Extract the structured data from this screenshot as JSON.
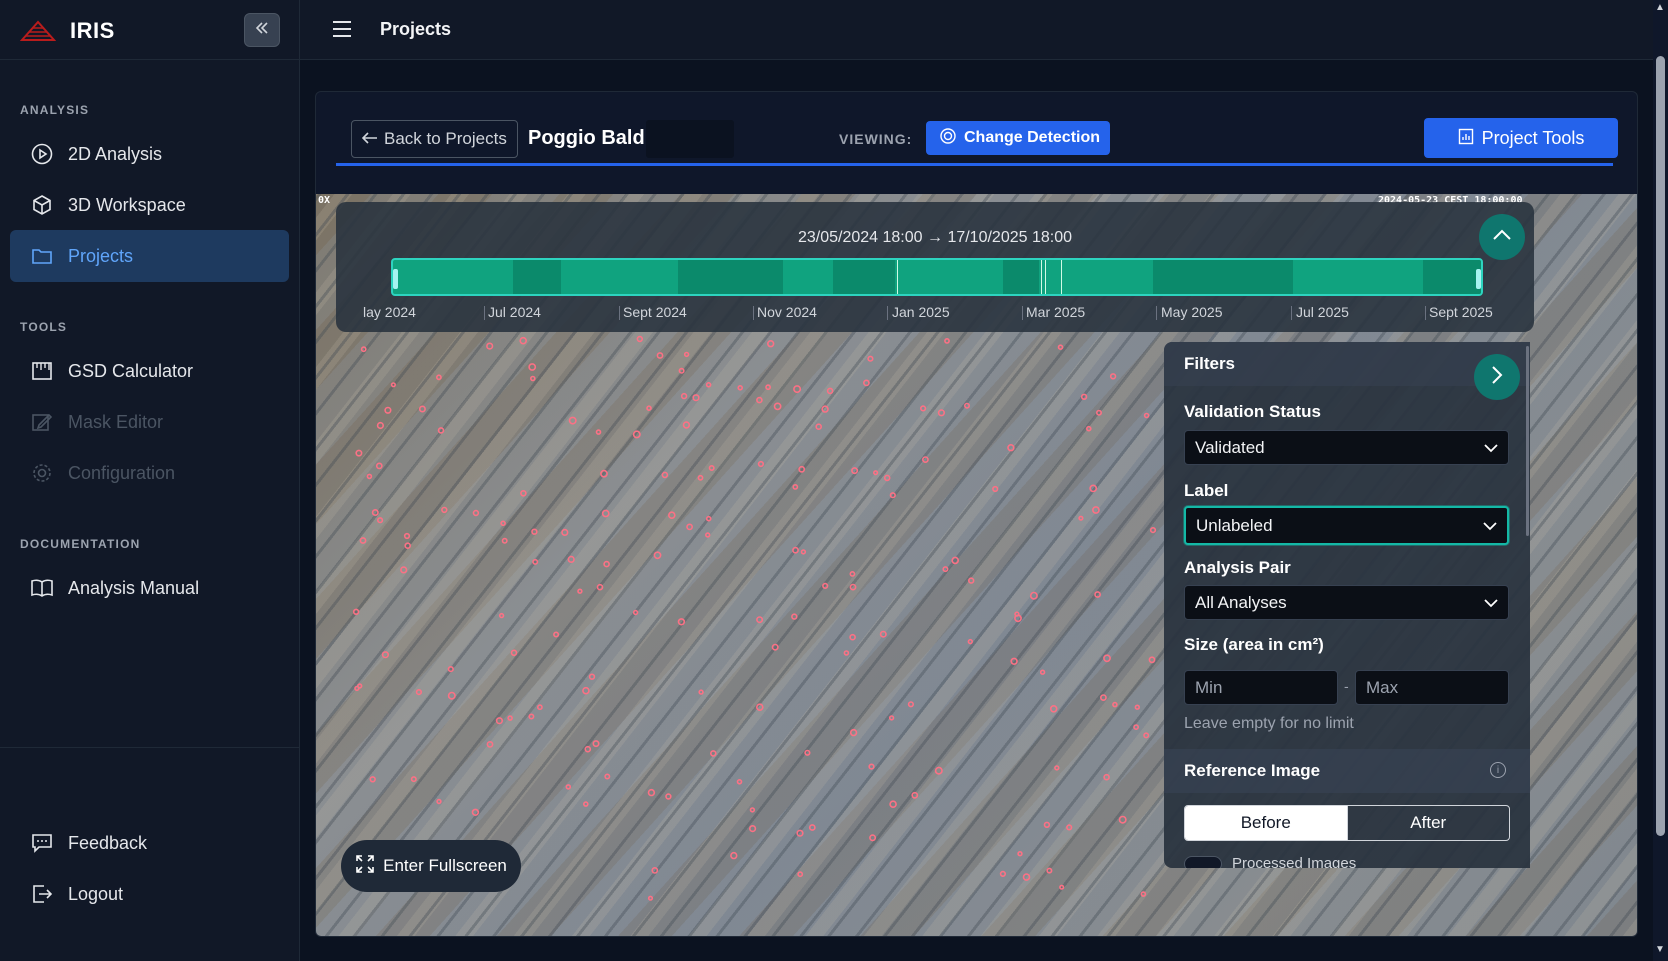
{
  "app": {
    "name": "IRIS"
  },
  "sidebar": {
    "sections": {
      "analysis": "ANALYSIS",
      "tools": "TOOLS",
      "documentation": "DOCUMENTATION"
    },
    "items": {
      "analysis_2d": "2D Analysis",
      "workspace_3d": "3D Workspace",
      "projects": "Projects",
      "gsd": "GSD Calculator",
      "mask": "Mask Editor",
      "config": "Configuration",
      "manual": "Analysis Manual",
      "feedback": "Feedback",
      "logout": "Logout"
    }
  },
  "header": {
    "title": "Projects"
  },
  "project": {
    "back_label": "Back to Projects",
    "name": "Poggio Baldi",
    "viewing_label": "VIEWING:",
    "mode_label": "Change Detection",
    "tools_label": "Project Tools"
  },
  "viewer": {
    "corner_left": "0X",
    "corner_right": "2024-05-23 CEST 18:00:00",
    "fullscreen_label": "Enter Fullscreen"
  },
  "timeline": {
    "range": "23/05/2024 18:00 → 17/10/2025 18:00",
    "ticks": [
      "lay 2024",
      "Jul 2024",
      "Sept 2024",
      "Nov 2024",
      "Jan 2025",
      "Mar 2025",
      "May 2025",
      "Jul 2025",
      "Sept 2025"
    ]
  },
  "filters": {
    "title": "Filters",
    "validation_label": "Validation Status",
    "validation_value": "Validated",
    "label_label": "Label",
    "label_value": "Unlabeled",
    "pair_label": "Analysis Pair",
    "pair_value": "All Analyses",
    "size_label": "Size (area in cm²)",
    "min_placeholder": "Min",
    "max_placeholder": "Max",
    "size_hint": "Leave empty for no limit",
    "ref_title": "Reference Image",
    "before_label": "Before",
    "after_label": "After",
    "processed_label": "Processed Images"
  },
  "colors": {
    "accent": "#2563eb",
    "teal": "#0f766e",
    "timeline_fill": "#10a37f",
    "marker": "#fb7185"
  }
}
